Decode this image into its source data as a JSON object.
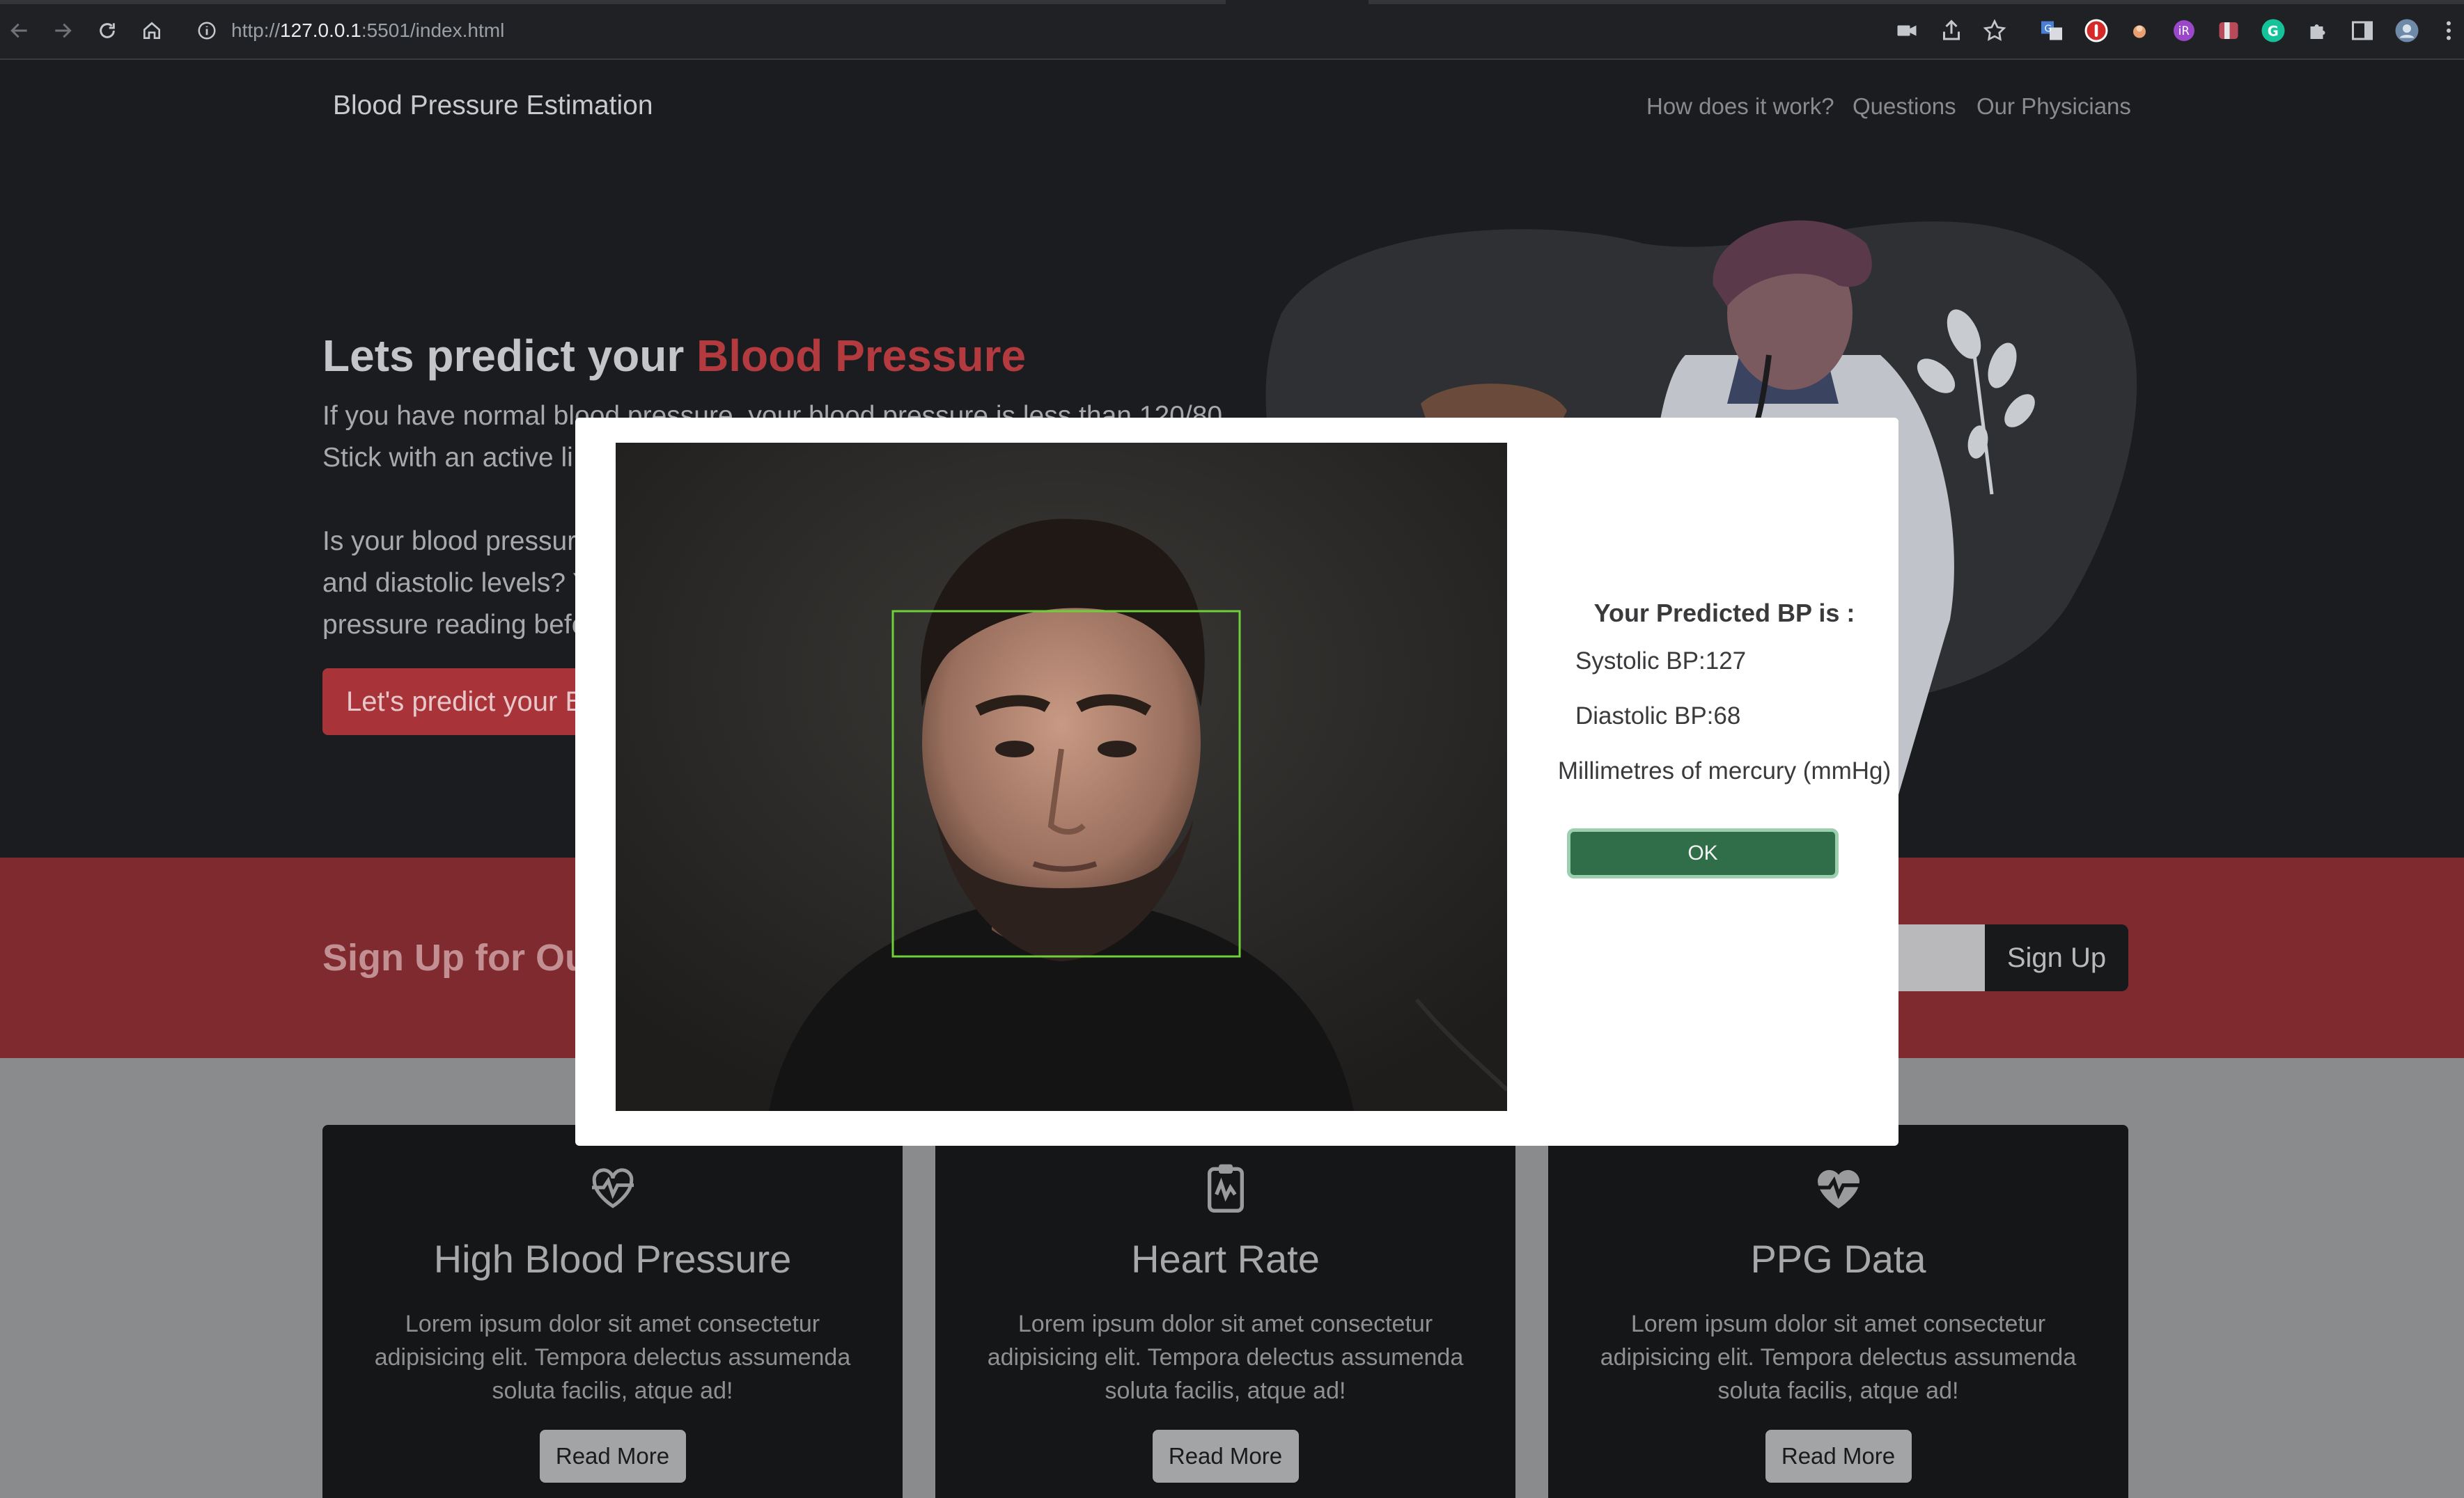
{
  "browser": {
    "url_prefix": "http://",
    "url_host": "127.0.0.1",
    "url_rest": ":5501/index.html",
    "icons": [
      "back-icon",
      "forward-icon",
      "reload-icon",
      "home-icon",
      "info-icon",
      "camera-icon",
      "share-icon",
      "star-icon",
      "translate-icon",
      "extension-icon",
      "profile-avatar-icon"
    ]
  },
  "navbar": {
    "brand": "Blood Pressure Estimation",
    "links": [
      "How does it work?",
      "Questions",
      "Our Physicians"
    ]
  },
  "hero": {
    "title_prefix": "Lets predict your",
    "title_accent": "Blood Pressure",
    "lines": [
      "If you have normal blood pressure, your blood pressure is less than 120/80",
      "Stick with an active li",
      "Is your blood pressur",
      "and diastolic levels? Y",
      "pressure reading befo"
    ],
    "button": "Let's predict your B"
  },
  "signup": {
    "title": "Sign Up for Ou",
    "button": "Sign Up"
  },
  "cards": [
    {
      "icon": "heartbeat-icon",
      "title": "High Blood Pressure",
      "text": "Lorem ipsum dolor sit amet consectetur adipisicing elit. Tempora delectus assumenda soluta facilis, atque ad!",
      "button": "Read More"
    },
    {
      "icon": "clipboard-pulse-icon",
      "title": "Heart Rate",
      "text": "Lorem ipsum dolor sit amet consectetur adipisicing elit. Tempora delectus assumenda soluta facilis, atque ad!",
      "button": "Read More"
    },
    {
      "icon": "heart-pulse-icon",
      "title": "PPG Data",
      "text": "Lorem ipsum dolor sit amet consectetur adipisicing elit. Tempora delectus assumenda soluta facilis, atque ad!",
      "button": "Read More"
    }
  ],
  "modal": {
    "heading": "Your Predicted BP is :",
    "systolic": "Systolic BP:127",
    "diastolic": "Diastolic BP:68",
    "unit": "Millimetres of mercury (mmHg)",
    "ok": "OK"
  },
  "colors": {
    "accent": "#b33a3f",
    "ok_button": "#2f6e49",
    "face_box": "#6fcf3a"
  }
}
